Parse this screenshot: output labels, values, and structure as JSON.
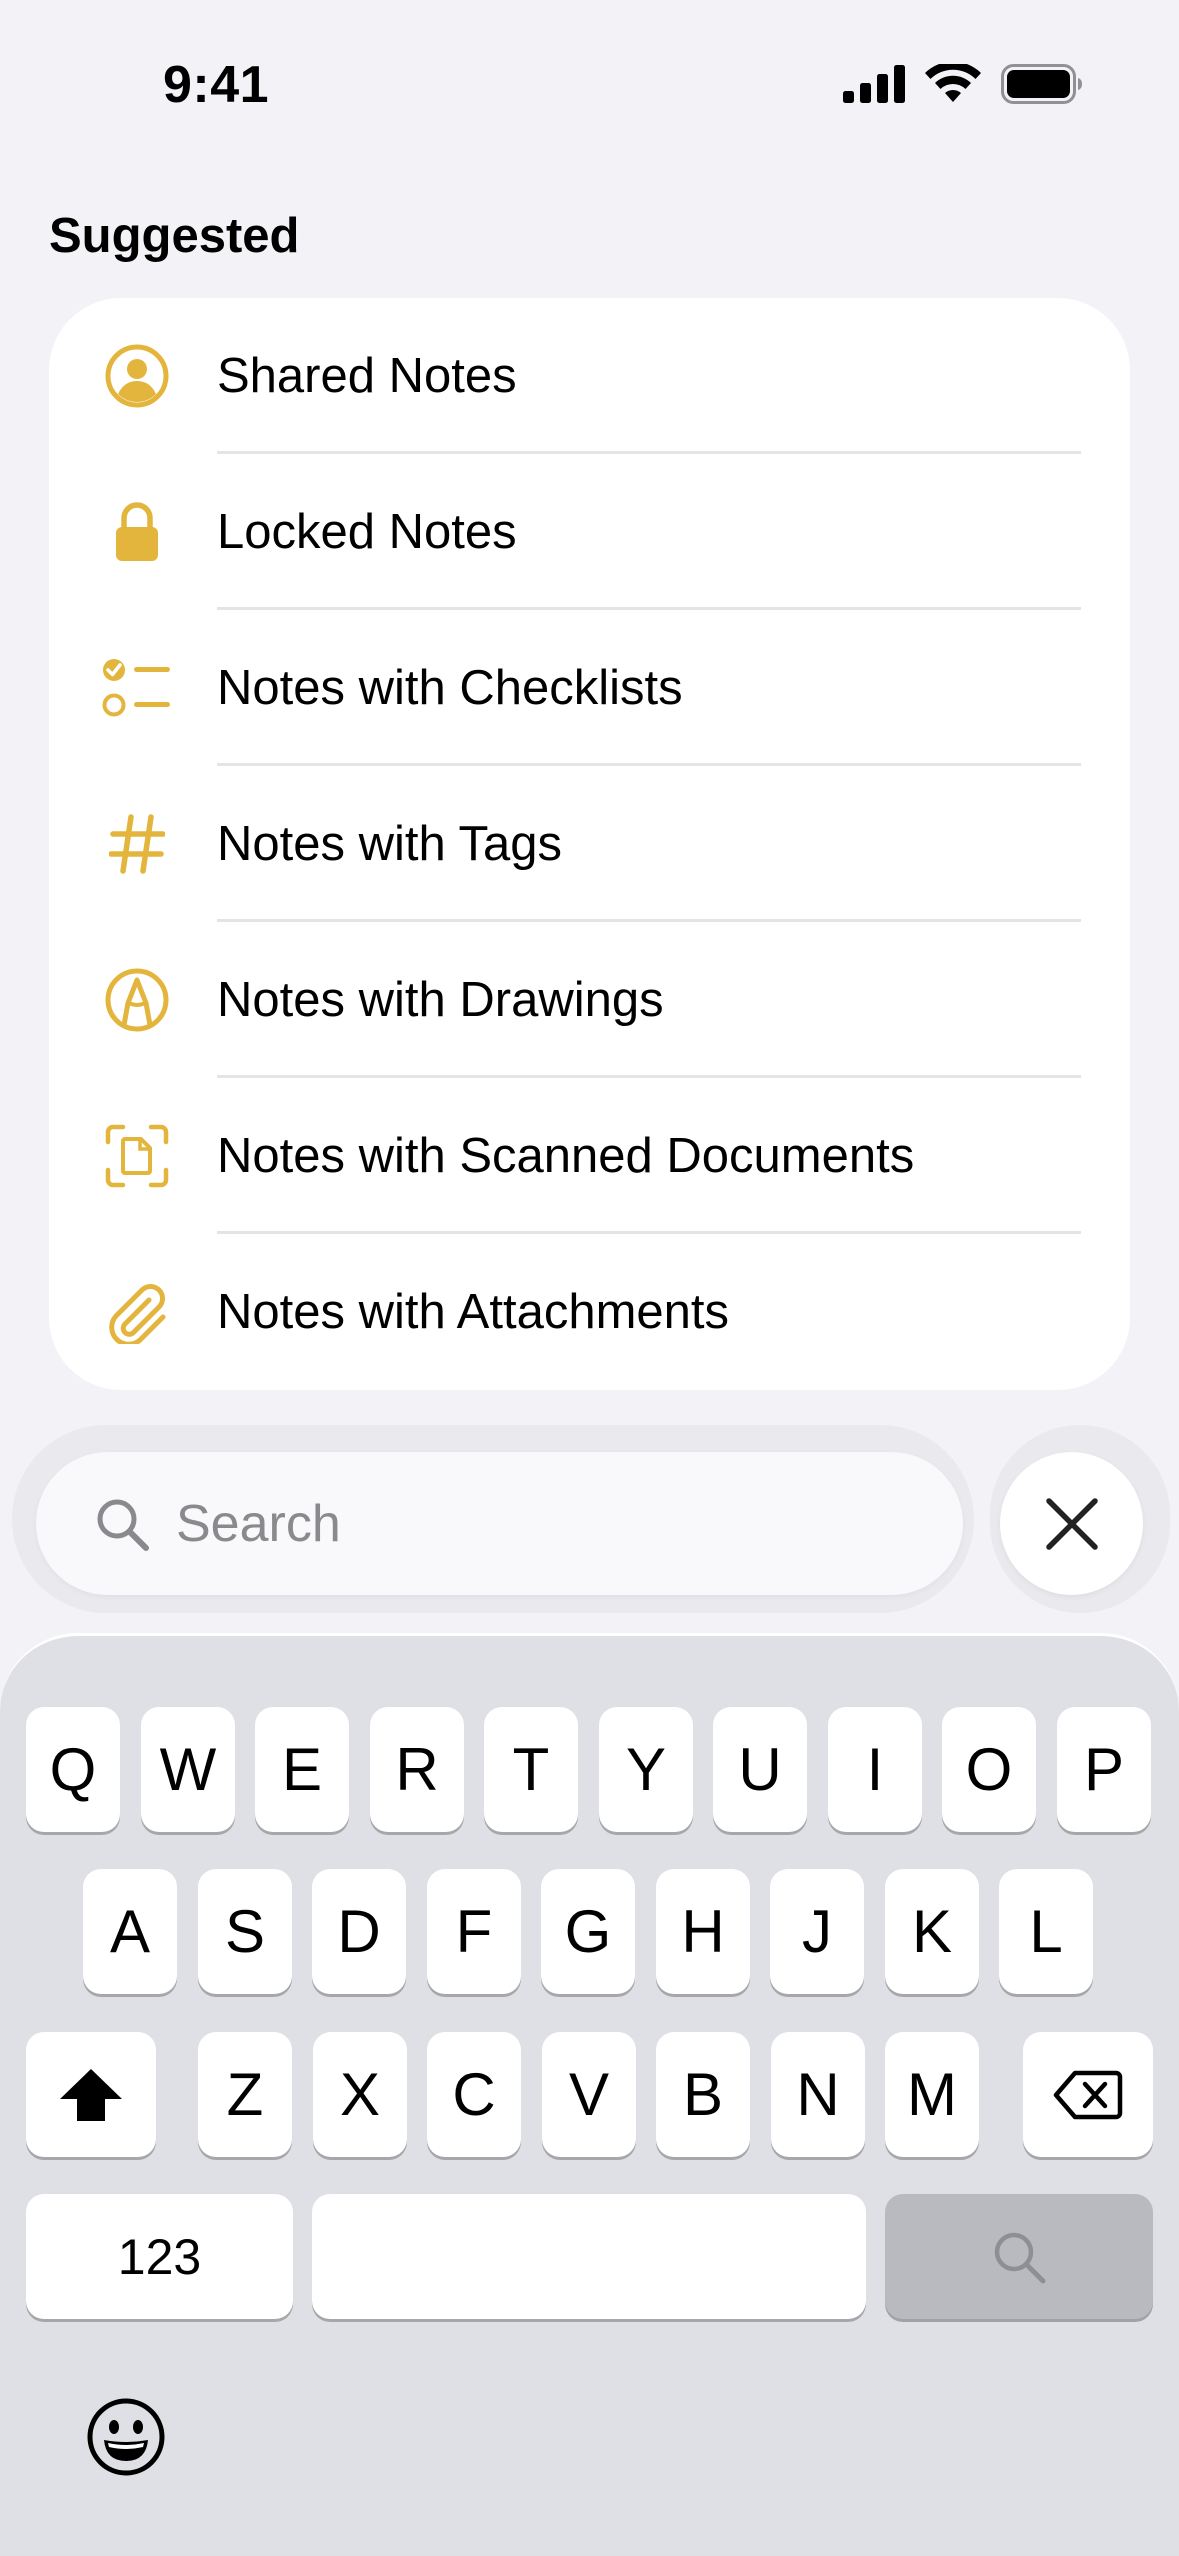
{
  "status_bar": {
    "time": "9:41"
  },
  "suggested": {
    "title": "Suggested",
    "items": [
      {
        "label": "Shared Notes",
        "icon": "person-circle-icon"
      },
      {
        "label": "Locked Notes",
        "icon": "lock-icon"
      },
      {
        "label": "Notes with Checklists",
        "icon": "checklist-icon"
      },
      {
        "label": "Notes with Tags",
        "icon": "hashtag-icon"
      },
      {
        "label": "Notes with Drawings",
        "icon": "pen-circle-icon"
      },
      {
        "label": "Notes with Scanned Documents",
        "icon": "scan-document-icon"
      },
      {
        "label": "Notes with Attachments",
        "icon": "paperclip-icon"
      }
    ]
  },
  "search": {
    "placeholder": "Search",
    "value": ""
  },
  "keyboard": {
    "row1": [
      "Q",
      "W",
      "E",
      "R",
      "T",
      "Y",
      "U",
      "I",
      "O",
      "P"
    ],
    "row2": [
      "A",
      "S",
      "D",
      "F",
      "G",
      "H",
      "J",
      "K",
      "L"
    ],
    "row3": [
      "Z",
      "X",
      "C",
      "V",
      "B",
      "N",
      "M"
    ],
    "numbers_label": "123"
  },
  "colors": {
    "accent": "#E3B53C",
    "background": "#F2F2F7",
    "card": "#FFFFFF",
    "keyboard": "#DFE0E5",
    "placeholder": "#8A8A8E"
  }
}
